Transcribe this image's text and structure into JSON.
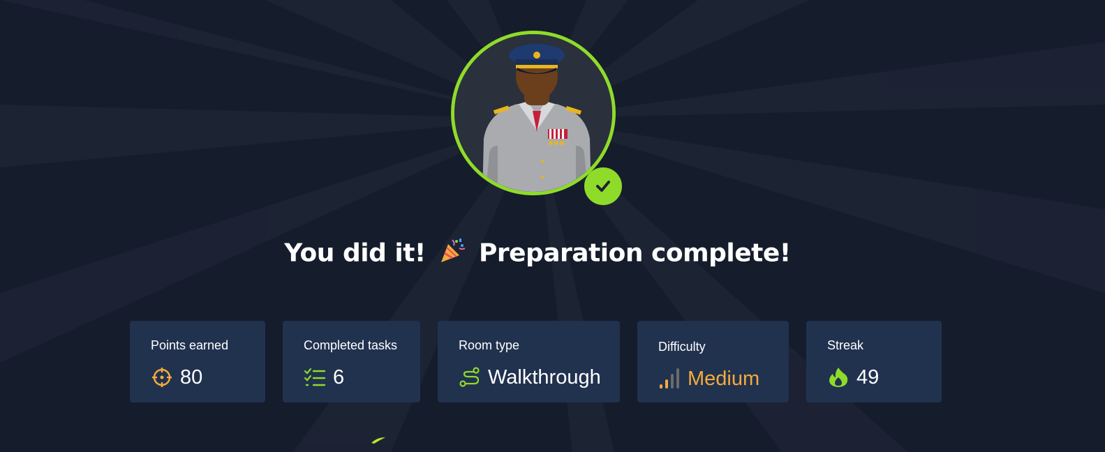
{
  "completion": {
    "headline_start": "You did it!",
    "headline_end": "Preparation complete!",
    "emoji": "🎉"
  },
  "avatar": {
    "icon": "officer-avatar",
    "badge_icon": "check-icon",
    "ring_color": "#8fdb2a"
  },
  "stats": [
    {
      "label": "Points earned",
      "value": "80",
      "icon": "target-icon",
      "icon_color": "#f6aa3b"
    },
    {
      "label": "Completed tasks",
      "value": "6",
      "icon": "task-list-icon",
      "icon_color": "#8fdb2a"
    },
    {
      "label": "Room type",
      "value": "Walkthrough",
      "icon": "route-icon",
      "icon_color": "#8fdb2a"
    },
    {
      "label": "Difficulty",
      "value": "Medium",
      "icon": "signal-bars-icon",
      "icon_color": "#f6aa3b"
    },
    {
      "label": "Streak",
      "value": "49",
      "icon": "flame-icon",
      "icon_color": "#8fdb2a"
    }
  ],
  "colors": {
    "background": "#151c2b",
    "card": "#21324f",
    "accent_green": "#8fdb2a",
    "accent_orange": "#f6aa3b"
  }
}
